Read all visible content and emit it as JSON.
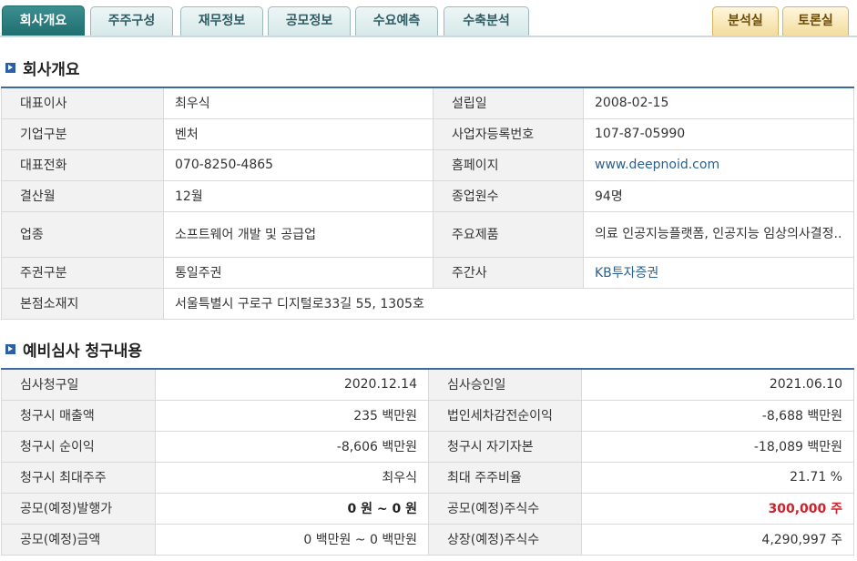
{
  "tabs": {
    "left": [
      "회사개요",
      "주주구성",
      "재무정보",
      "공모정보",
      "수요예측",
      "수축분석"
    ],
    "right": [
      "분석실",
      "토론실"
    ]
  },
  "section1": {
    "title": "회사개요",
    "rows": [
      {
        "k1": "대표이사",
        "v1": "최우식",
        "k2": "설립일",
        "v2": "2008-02-15"
      },
      {
        "k1": "기업구분",
        "v1": "벤처",
        "k2": "사업자등록번호",
        "v2": "107-87-05990"
      },
      {
        "k1": "대표전화",
        "v1": "070-8250-4865",
        "k2": "홈페이지",
        "v2": "www.deepnoid.com"
      },
      {
        "k1": "결산월",
        "v1": "12월",
        "k2": "종업원수",
        "v2": "94명"
      },
      {
        "k1": "업종",
        "v1": "소프트웨어 개발 및 공급업",
        "k2": "주요제품",
        "v2": "의료 인공지능플랫폼, 인공지능 임상의사결정.."
      },
      {
        "k1": "주권구분",
        "v1": "통일주권",
        "k2": "주간사",
        "v2": "KB투자증권"
      },
      {
        "k1": "본점소재지",
        "v1": "서울특별시 구로구 디지털로33길 55, 1305호"
      }
    ]
  },
  "section2": {
    "title": "예비심사 청구내용",
    "rows": [
      {
        "k1": "심사청구일",
        "v1": "2020.12.14",
        "k2": "심사승인일",
        "v2": "2021.06.10"
      },
      {
        "k1": "청구시 매출액",
        "v1": "235 백만원",
        "k2": "법인세차감전순이익",
        "v2": "-8,688 백만원"
      },
      {
        "k1": "청구시 순이익",
        "v1": "-8,606 백만원",
        "k2": "청구시 자기자본",
        "v2": "-18,089 백만원"
      },
      {
        "k1": "청구시 최대주주",
        "v1": "최우식",
        "k2": "최대 주주비율",
        "v2": "21.71 %"
      },
      {
        "k1": "공모(예정)발행가",
        "v1": "0 원 ~ 0 원",
        "k2": "공모(예정)주식수",
        "v2": "300,000 주"
      },
      {
        "k1": "공모(예정)금액",
        "v1": "0 백만원 ~ 0 백만원",
        "k2": "상장(예정)주식수",
        "v2": "4,290,997 주"
      }
    ]
  },
  "colors": {
    "active_tab": "#1f6c6e",
    "accent_blue": "#3d6aa0",
    "highlight_red": "#d0202a",
    "link": "#2a5f8e"
  }
}
